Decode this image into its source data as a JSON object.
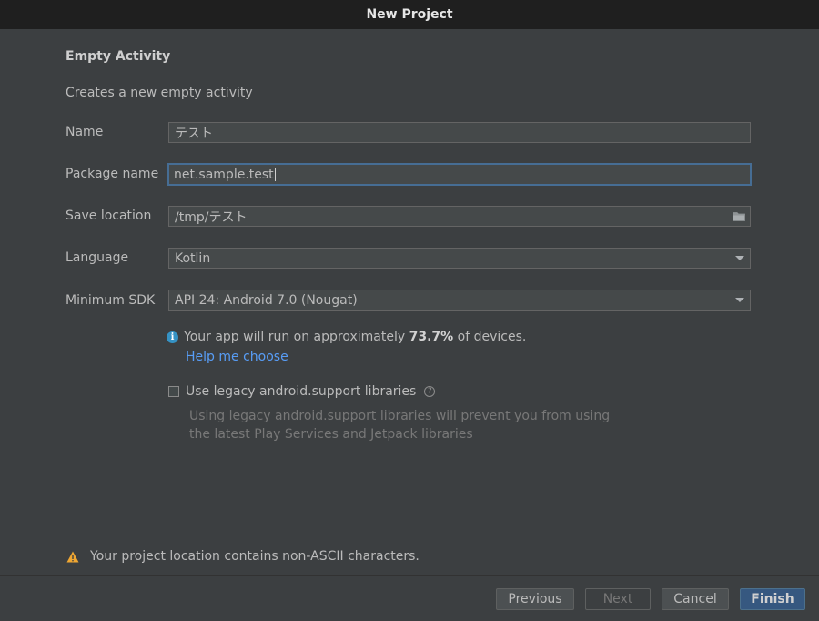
{
  "window": {
    "title": "New Project"
  },
  "template": {
    "heading": "Empty Activity",
    "description": "Creates a new empty activity"
  },
  "form": {
    "name": {
      "label": "Name",
      "value": "テスト"
    },
    "package": {
      "label": "Package name",
      "value": "net.sample.test"
    },
    "location": {
      "label": "Save location",
      "value": "/tmp/テスト",
      "icon": "folder-icon"
    },
    "language": {
      "label": "Language",
      "value": "Kotlin"
    },
    "sdk": {
      "label": "Minimum SDK",
      "value": "API 24: Android 7.0 (Nougat)"
    }
  },
  "info": {
    "prefix": "Your app will run on approximately ",
    "percent": "73.7%",
    "suffix": " of devices.",
    "help_link": "Help me choose",
    "icon": "info-icon",
    "color": "#3592c4"
  },
  "legacy": {
    "checked": false,
    "label": "Use legacy android.support libraries",
    "desc_line1": "Using legacy android.support libraries will prevent you from using",
    "desc_line2": "the latest Play Services and Jetpack libraries"
  },
  "warning": {
    "text": "Your project location contains non-ASCII characters.",
    "icon": "warning-icon",
    "color": "#f0a732"
  },
  "buttons": {
    "previous": "Previous",
    "next": "Next",
    "cancel": "Cancel",
    "finish": "Finish"
  },
  "colors": {
    "background": "#3c3f41",
    "accent": "#365880",
    "link": "#589df6"
  }
}
